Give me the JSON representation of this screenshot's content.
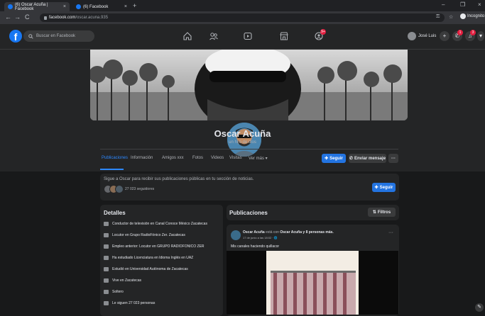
{
  "browser": {
    "tabs": [
      {
        "label": "(6) Oscar Acuña | Facebook",
        "close": "×",
        "active": true
      },
      {
        "label": "(6) Facebook",
        "close": "×",
        "active": false
      }
    ],
    "new_tab": "+",
    "window_controls": {
      "minimize": "–",
      "restore": "❐",
      "close": "×"
    },
    "nav": {
      "back": "←",
      "forward": "→",
      "reload": "C"
    },
    "url_domain": "facebook.com",
    "url_path": "/oscar.acuna.935",
    "profile_label": "Incognito"
  },
  "fb": {
    "search_placeholder": "Buscar en Facebook",
    "user_name": "José Luis",
    "nav_icons": [
      "home-icon",
      "friends-icon",
      "watch-icon",
      "marketplace-icon",
      "groups-icon"
    ],
    "groups_badge": "9+",
    "messenger_badge": "1",
    "notifications_badge": "3",
    "accent": "#2374e1",
    "badge_color": "#e41e3f"
  },
  "profile": {
    "name": "Oscar Acuña",
    "bio": "un hijo de dios",
    "tabs": [
      "Publicaciones",
      "Información",
      "Amigos xxx",
      "Fotos",
      "Videos",
      "Visitas",
      "Ver más ▾"
    ],
    "follow_button": "Seguir",
    "message_button": "Enviar mensaje",
    "more_button": "···"
  },
  "follow_card": {
    "text": "Sigue a Oscar para recibir sus publicaciones públicas en tu sección de noticias.",
    "followers": "27 023 seguidores",
    "button": "Seguir"
  },
  "details": {
    "title": "Detalles",
    "items": [
      "Conductor de televisión en Canal Conoce México Zacatecas",
      "Locutor en Grupo RadioFónico Zer. Zacatecas",
      "Empleo anterior: Locutor en GRUPO RADIOFONICO ZER",
      "Ha estudiado Licenciatura en Idioma Inglés en UAZ",
      "Estudió en Universidad Autónoma de Zacatecas",
      "Vive en Zacatecas",
      "Soltero",
      "Le siguen 27 023 personas"
    ]
  },
  "posts": {
    "title": "Publicaciones",
    "filter_button": "Filtros",
    "post": {
      "author": "Oscar Acuña",
      "connector": "está con",
      "with": "Oscar Acuña y 8 personas más.",
      "date": "17 de junio a las 18:02 · 🌐",
      "text": "Mis canales haciendo quillacor",
      "more": "···"
    }
  },
  "edit_fab": "✎"
}
